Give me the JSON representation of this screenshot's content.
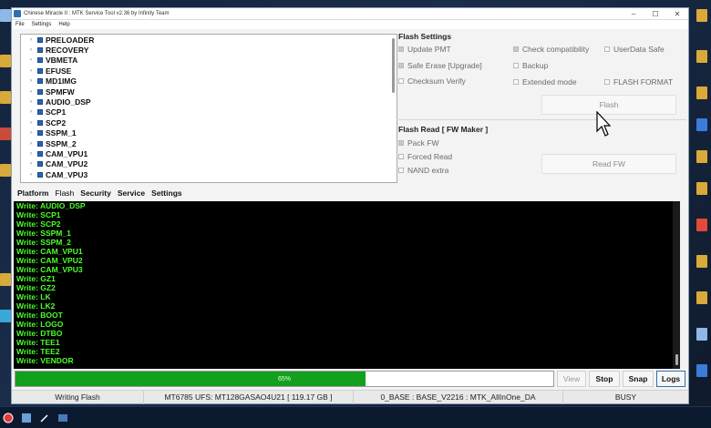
{
  "window": {
    "title": "Chinese Miracle II : MTK Service Tool v2.36 by Infinity Team",
    "menu": [
      "File",
      "Settings",
      "Help"
    ],
    "controls": [
      "–",
      "☐",
      "✕"
    ]
  },
  "partitions": [
    "PRELOADER",
    "RECOVERY",
    "VBMETA",
    "EFUSE",
    "MD1IMG",
    "SPMFW",
    "AUDIO_DSP",
    "SCP1",
    "SCP2",
    "SSPM_1",
    "SSPM_2",
    "CAM_VPU1",
    "CAM_VPU2",
    "CAM_VPU3"
  ],
  "flash_settings": {
    "title": "Flash Settings",
    "options": {
      "update_pmt": "Update PMT",
      "check_compat": "Check compatibility",
      "userdata_safe": "UserData Safe",
      "safe_erase": "Safe Erase [Upgrade]",
      "backup": "Backup",
      "checksum_verify": "Checksum Verify",
      "extended_mode": "Extended mode",
      "flash_format": "FLASH FORMAT"
    },
    "flash_button": "Flash"
  },
  "flash_read": {
    "title": "Flash Read [ FW Maker ]",
    "options": {
      "pack_fw": "Pack FW",
      "forced_read": "Forced Read",
      "nand_extra": "NAND extra"
    },
    "read_button": "Read FW"
  },
  "tabs": [
    "Platform",
    "Flash",
    "Security",
    "Service",
    "Settings"
  ],
  "log_lines": [
    "Write: AUDIO_DSP",
    "Write: SCP1",
    "Write: SCP2",
    "Write: SSPM_1",
    "Write: SSPM_2",
    "Write: CAM_VPU1",
    "Write: CAM_VPU2",
    "Write: CAM_VPU3",
    "Write: GZ1",
    "Write: GZ2",
    "Write: LK",
    "Write: LK2",
    "Write: BOOT",
    "Write: LOGO",
    "Write: DTBO",
    "Write: TEE1",
    "Write: TEE2",
    "Write: VENDOR"
  ],
  "progress": {
    "percent": 65,
    "label": "65%",
    "fill_color": "#12a01e"
  },
  "toolbar": {
    "view": "View",
    "stop": "Stop",
    "snap": "Snap",
    "logs": "Logs"
  },
  "status": {
    "state": "Writing Flash",
    "device": "MT6785 UFS: MT128GASAO4U21  [ 119.17 GB ]",
    "firmware": "0_BASE : BASE_V2216 : MTK_AllInOne_DA",
    "busy": "BUSY"
  },
  "colors": {
    "log_text": "#4cff2a",
    "log_bg": "#000000",
    "accent": "#2a63b0"
  }
}
